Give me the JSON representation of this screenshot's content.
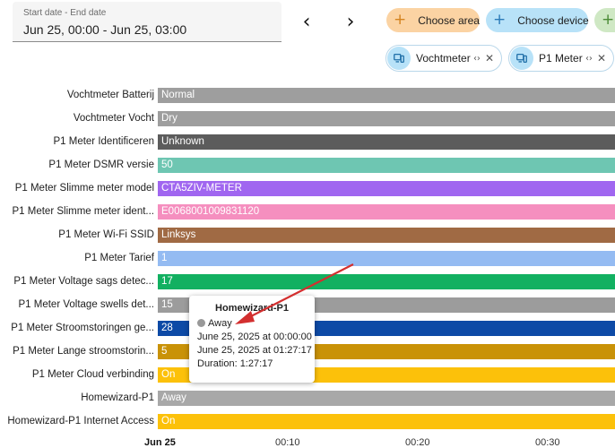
{
  "date_picker": {
    "label": "Start date - End date",
    "value": "Jun 25, 00:00 - Jun 25, 03:00"
  },
  "nav": {
    "prev_icon": "chevron-left-icon",
    "next_icon": "chevron-right-icon"
  },
  "targets": {
    "choose_area": "Choose area",
    "choose_device": "Choose device",
    "chips": [
      {
        "name": "Vochtmeter",
        "icon": "device-icon"
      },
      {
        "name": "P1 Meter",
        "icon": "device-icon"
      }
    ]
  },
  "timeline": {
    "rows": [
      {
        "label": "Vochtmeter Batterij",
        "state": "Normal",
        "color": "#9e9e9e"
      },
      {
        "label": "Vochtmeter Vocht",
        "state": "Dry",
        "color": "#9e9e9e"
      },
      {
        "label": "P1 Meter Identificeren",
        "state": "Unknown",
        "color": "#5c5c5c"
      },
      {
        "label": "P1 Meter DSMR versie",
        "state": "50",
        "color": "#6ec6b2"
      },
      {
        "label": "P1 Meter Slimme meter model",
        "state": "CTA5ZIV-METER",
        "color": "#a066f0"
      },
      {
        "label": "P1 Meter Slimme meter ident...",
        "state": "E0068001009831120",
        "color": "#f58fbf"
      },
      {
        "label": "P1 Meter Wi-Fi SSID",
        "state": "Linksys",
        "color": "#a06a44"
      },
      {
        "label": "P1 Meter Tarief",
        "state": "1",
        "color": "#94bbf2"
      },
      {
        "label": "P1 Meter Voltage sags detec...",
        "state": "17",
        "color": "#12b061"
      },
      {
        "label": "P1 Meter Voltage swells det...",
        "state": "15",
        "color": "#9c9c9c"
      },
      {
        "label": "P1 Meter Stroomstoringen ge...",
        "state": "28",
        "color": "#0d4aa6"
      },
      {
        "label": "P1 Meter Lange stroomstorin...",
        "state": "5",
        "color": "#c99207"
      },
      {
        "label": "P1 Meter Cloud verbinding",
        "state": "On",
        "color": "#fcc10a"
      },
      {
        "label": "Homewizard-P1",
        "state": "Away",
        "color": "#a8a8a8"
      },
      {
        "label": "Homewizard-P1 Internet Access",
        "state": "On",
        "color": "#fcc10a"
      }
    ],
    "axis": [
      "Jun 25",
      "00:10",
      "00:20",
      "00:30"
    ]
  },
  "tooltip": {
    "title": "Homewizard-P1",
    "state": "Away",
    "start": "June 25, 2025 at 00:00:00",
    "end": "June 25, 2025 at 01:27:17",
    "duration": "Duration: 1:27:17",
    "dot_color": "#999999"
  },
  "colors": {
    "arrow": "#d32f2f"
  }
}
